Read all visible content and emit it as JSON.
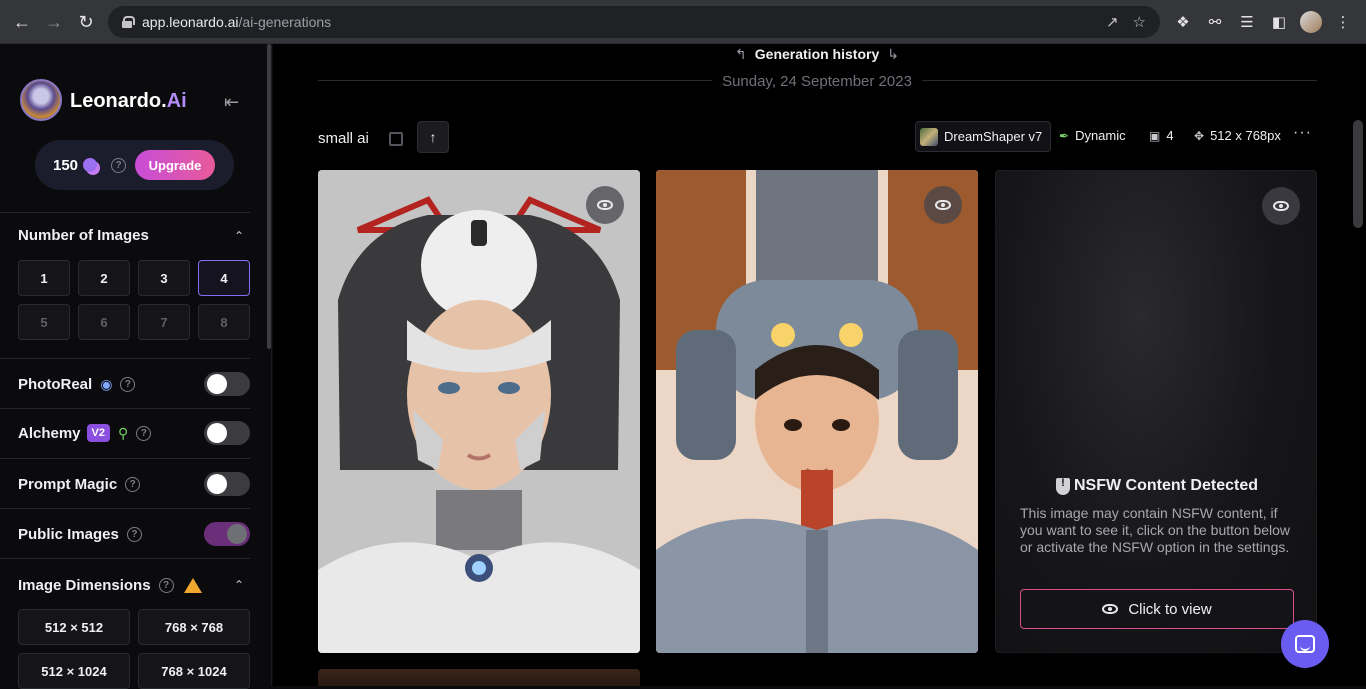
{
  "browser": {
    "url_domain": "app.leonardo.ai",
    "url_path": "/ai-generations",
    "back_icon": "arrow-left-icon",
    "forward_icon": "arrow-right-icon",
    "reload_icon": "reload-icon"
  },
  "sidebar": {
    "brand_name": "Leonardo.",
    "brand_ai": "Ai",
    "credits": "150",
    "upgrade_label": "Upgrade",
    "num_images": {
      "title": "Number of Images",
      "options": [
        "1",
        "2",
        "3",
        "4",
        "5",
        "6",
        "7",
        "8"
      ],
      "selected": "4"
    },
    "toggles": {
      "photoreal": "PhotoReal",
      "alchemy": "Alchemy",
      "alchemy_badge": "V2",
      "prompt_magic": "Prompt Magic",
      "public_images": "Public Images"
    },
    "dimensions": {
      "title": "Image Dimensions",
      "options": [
        "512 × 512",
        "768 × 768",
        "512 × 1024",
        "768 × 1024"
      ]
    }
  },
  "main": {
    "generation_history": "Generation history",
    "date": "Sunday, 24 September 2023",
    "generation_title": "small ai",
    "model": "DreamShaper v7",
    "style": "Dynamic",
    "image_count": "4",
    "resolution": "512 x 768px",
    "nsfw": {
      "title": "NSFW Content Detected",
      "text": "This image may contain NSFW content, if you want to see it, click on the button below or activate the NSFW option in the settings.",
      "button": "Click to view"
    }
  },
  "colors": {
    "accent_purple": "#8c6cf2",
    "upgrade_gradient_start": "#c84dd8",
    "upgrade_gradient_end": "#e85a9a",
    "nsfw_button_border": "#d94d8c",
    "chat_bubble": "#6a5cf0"
  }
}
